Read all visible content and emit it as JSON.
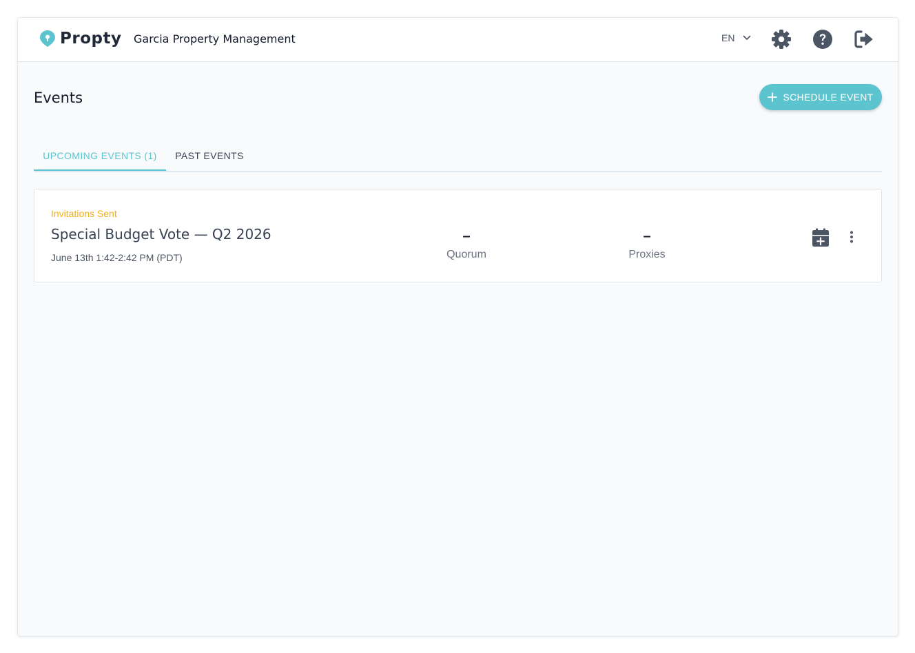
{
  "header": {
    "brand": "Propty",
    "org_name": "Garcia Property Management",
    "language": "EN",
    "icons": [
      "logo-pin-icon",
      "chevron-down-icon",
      "gear-icon",
      "help-icon",
      "logout-icon"
    ]
  },
  "page": {
    "title": "Events",
    "schedule_button": "SCHEDULE EVENT"
  },
  "tabs": [
    {
      "label": "UPCOMING EVENTS (1)",
      "active": true
    },
    {
      "label": "PAST EVENTS",
      "active": false
    }
  ],
  "events": [
    {
      "status": "Invitations Sent",
      "title": "Special Budget Vote — Q2 2026",
      "time": "June 13th 1:42-2:42 PM (PDT)",
      "quorum_value": "–",
      "quorum_label": "Quorum",
      "proxies_value": "–",
      "proxies_label": "Proxies",
      "icons": [
        "calendar-add-icon",
        "more-vertical-icon"
      ]
    }
  ],
  "colors": {
    "accent": "#5cc4ce",
    "status": "#f5b014",
    "icon": "#4b5563"
  }
}
